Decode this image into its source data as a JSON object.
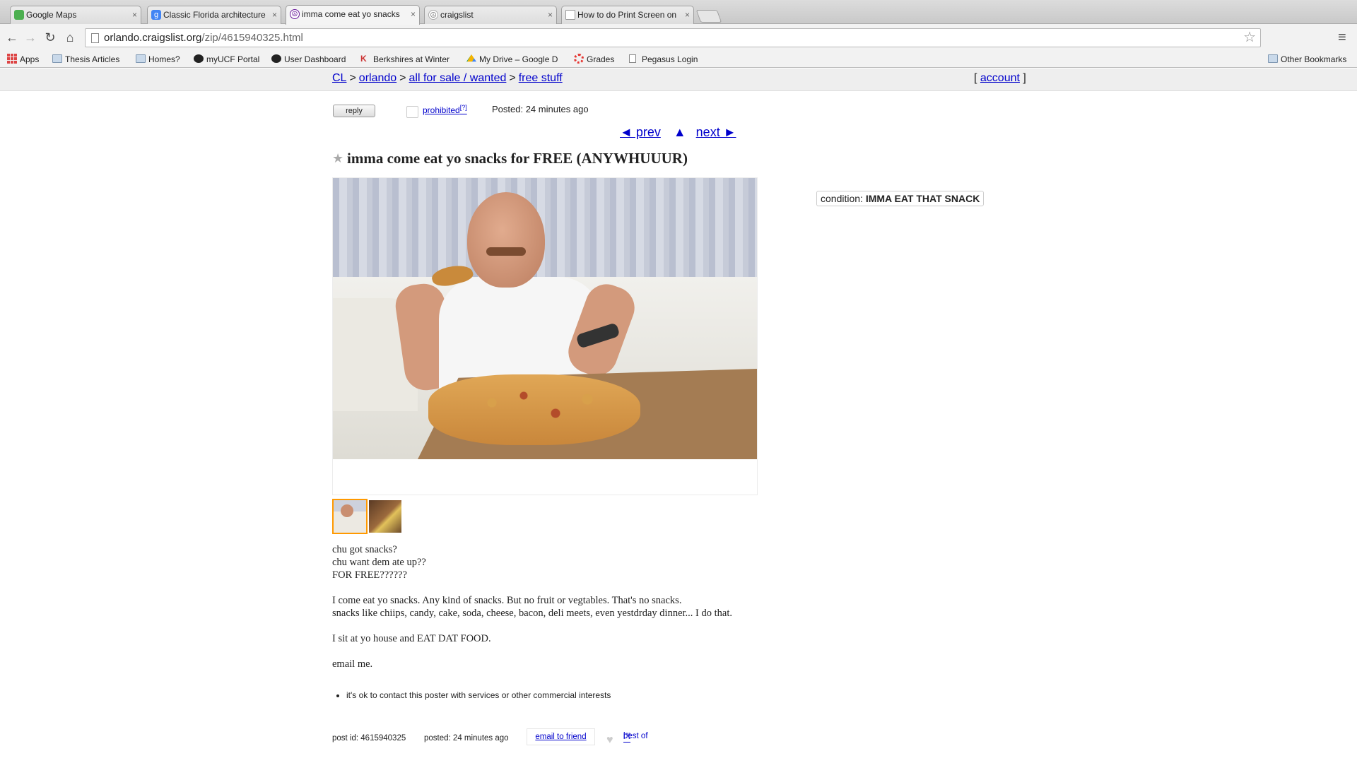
{
  "browser": {
    "tabs": [
      {
        "title": "Google Maps",
        "color": "#4caf50"
      },
      {
        "title": "Classic Florida architecture",
        "color": "#4285f4"
      },
      {
        "title": "imma come eat yo snacks",
        "color": "#6a1b9a"
      },
      {
        "title": "craigslist",
        "color": "#ff6f00"
      },
      {
        "title": "How to do Print Screen on",
        "color": "#ffffff"
      }
    ],
    "tab_close": "×",
    "address": {
      "domain": "orlando.craigslist.org",
      "path": "/zip/4615940325.html"
    },
    "nav": {
      "back": "←",
      "forward": "→",
      "reload": "↻",
      "home": "⌂",
      "star": "☆",
      "menu": "≡"
    },
    "bookmarks": [
      {
        "label": "Apps",
        "icon": "apps-grid-icon"
      },
      {
        "label": "Thesis Articles",
        "icon": "folder-icon"
      },
      {
        "label": "Homes?",
        "icon": "folder-icon"
      },
      {
        "label": "myUCF Portal",
        "icon": "pegasus-icon"
      },
      {
        "label": "User Dashboard",
        "icon": "pegasus-icon"
      },
      {
        "label": "Berkshires at Winter",
        "icon": "k-icon"
      },
      {
        "label": "My Drive – Google D",
        "icon": "drive-icon"
      },
      {
        "label": "Grades",
        "icon": "gear-icon"
      },
      {
        "label": "Pegasus Login",
        "icon": "page-icon"
      }
    ],
    "other_bookmarks": "Other Bookmarks"
  },
  "header": {
    "crumbs": [
      "CL",
      "orlando",
      "all for sale / wanted",
      "free stuff"
    ],
    "separator": ">",
    "account_open": "[",
    "account": "account",
    "account_close": "]"
  },
  "post": {
    "reply": "reply",
    "prohibited": "prohibited",
    "help_sup": "[?]",
    "posted_top": "Posted: 24 minutes ago",
    "prev": "◄ prev",
    "up": "▲",
    "next": "next ►",
    "title": "imma come eat yo snacks for FREE (ANYWHUUUR)",
    "star": "★",
    "condition_label": "condition:",
    "condition_value": "IMMA EAT THAT SNACK",
    "body": [
      "chu got snacks?",
      "chu want dem ate up??",
      "FOR FREE??????",
      "",
      "I come eat yo snacks. Any kind of snacks. But no fruit or vegtables. That's no snacks.",
      "snacks like chiips, candy, cake, soda, cheese, bacon, deli meets, even yestdrday dinner... I do that.",
      "",
      "I sit at yo house and EAT DAT FOOD.",
      "",
      "email me."
    ],
    "notice": "it's ok to contact this poster with services or other commercial interests",
    "footer": {
      "post_id": "post id: 4615940325",
      "posted": "posted: 24 minutes ago",
      "email_friend": "email to friend",
      "heart": "♥",
      "best_of": "best of"
    }
  }
}
